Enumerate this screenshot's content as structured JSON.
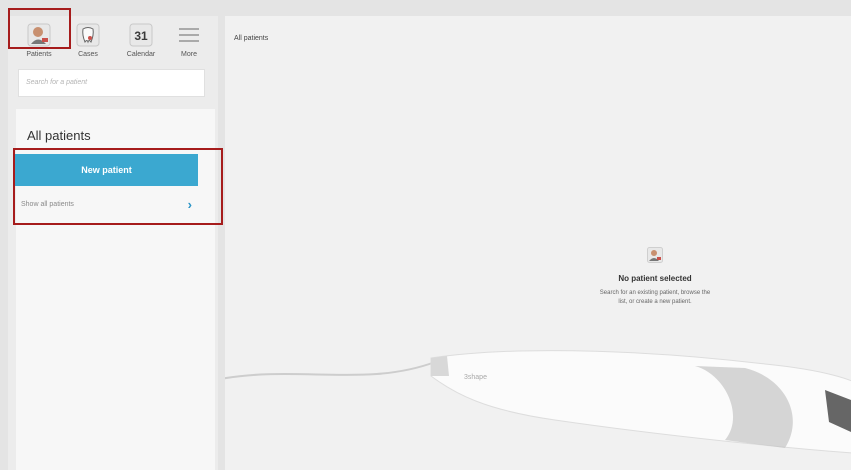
{
  "toolbar": {
    "items": [
      {
        "label": "Patients",
        "icon": "patient-icon"
      },
      {
        "label": "Cases",
        "icon": "tooth-icon"
      },
      {
        "label": "Calendar",
        "icon": "calendar-icon"
      },
      {
        "label": "More",
        "icon": "menu-icon"
      }
    ]
  },
  "sidebar": {
    "search_placeholder": "Search for a patient",
    "list_title": "All patients",
    "new_patient_label": "New patient",
    "show_all_label": "Show all patients"
  },
  "main": {
    "breadcrumb": "All patients",
    "empty_title": "No patient selected",
    "empty_desc_line1": "Search for an existing patient, browse the",
    "empty_desc_line2": "list, or create a new patient.",
    "brand_text": "3shape"
  },
  "colors": {
    "accent": "#3ba8d0",
    "highlight": "#a61c1c"
  }
}
